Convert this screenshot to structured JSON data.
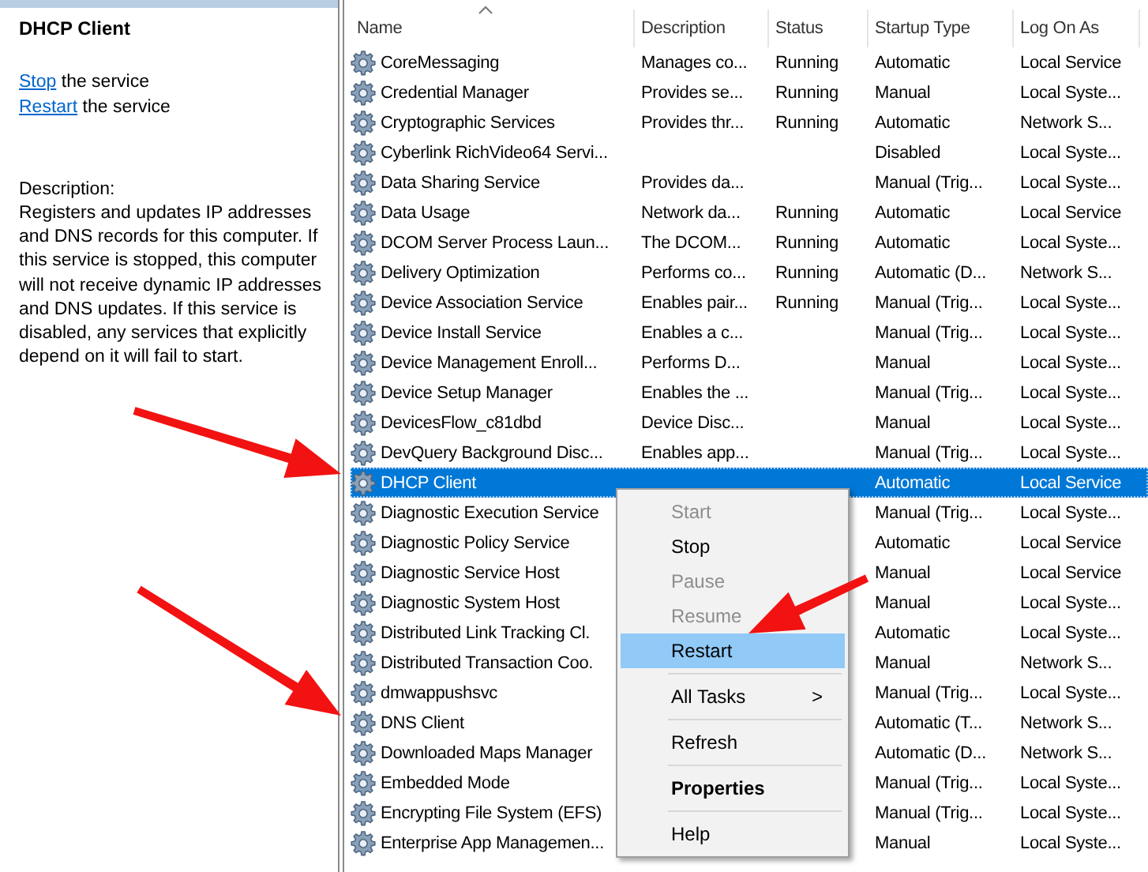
{
  "details": {
    "title": "DHCP Client",
    "actions": [
      {
        "link": "Stop",
        "text": "the service"
      },
      {
        "link": "Restart",
        "text": "the service"
      }
    ],
    "description_label": "Description:",
    "description": "Registers and updates IP addresses and DNS records for this computer. If this service is stopped, this computer will not receive dynamic IP addresses and DNS updates. If this service is disabled, any services that explicitly depend on it will fail to start."
  },
  "table": {
    "columns": [
      "Name",
      "Description",
      "Status",
      "Startup Type",
      "Log On As"
    ],
    "rows": [
      {
        "name": "CoreMessaging",
        "description": "Manages co...",
        "status": "Running",
        "startup": "Automatic",
        "logon": "Local Service",
        "selected": false
      },
      {
        "name": "Credential Manager",
        "description": "Provides se...",
        "status": "Running",
        "startup": "Manual",
        "logon": "Local Syste...",
        "selected": false
      },
      {
        "name": "Cryptographic Services",
        "description": "Provides thr...",
        "status": "Running",
        "startup": "Automatic",
        "logon": "Network S...",
        "selected": false
      },
      {
        "name": "Cyberlink RichVideo64 Servi...",
        "startup": "Disabled",
        "logon": "Local Syste...",
        "selected": false
      },
      {
        "name": "Data Sharing Service",
        "description": "Provides da...",
        "startup": "Manual (Trig...",
        "logon": "Local Syste...",
        "selected": false
      },
      {
        "name": "Data Usage",
        "description": "Network da...",
        "status": "Running",
        "startup": "Automatic",
        "logon": "Local Service",
        "selected": false
      },
      {
        "name": "DCOM Server Process Laun...",
        "description": "The DCOM...",
        "status": "Running",
        "startup": "Automatic",
        "logon": "Local Syste...",
        "selected": false
      },
      {
        "name": "Delivery Optimization",
        "description": "Performs co...",
        "status": "Running",
        "startup": "Automatic (D...",
        "logon": "Network S...",
        "selected": false
      },
      {
        "name": "Device Association Service",
        "description": "Enables pair...",
        "status": "Running",
        "startup": "Manual (Trig...",
        "logon": "Local Syste...",
        "selected": false
      },
      {
        "name": "Device Install Service",
        "description": "Enables a c...",
        "startup": "Manual (Trig...",
        "logon": "Local Syste...",
        "selected": false
      },
      {
        "name": "Device Management Enroll...",
        "description": "Performs D...",
        "startup": "Manual",
        "logon": "Local Syste...",
        "selected": false
      },
      {
        "name": "Device Setup Manager",
        "description": "Enables the ...",
        "startup": "Manual (Trig...",
        "logon": "Local Syste...",
        "selected": false
      },
      {
        "name": "DevicesFlow_c81dbd",
        "description": "Device Disc...",
        "startup": "Manual",
        "logon": "Local Syste...",
        "selected": false
      },
      {
        "name": "DevQuery Background Disc...",
        "description": "Enables app...",
        "startup": "Manual (Trig...",
        "logon": "Local Syste...",
        "selected": false
      },
      {
        "name": "DHCP Client",
        "startup": "Automatic",
        "logon": "Local Service",
        "selected": true
      },
      {
        "name": "Diagnostic Execution Service",
        "startup": "Manual (Trig...",
        "logon": "Local Syste...",
        "selected": false
      },
      {
        "name": "Diagnostic Policy Service",
        "startup": "Automatic",
        "logon": "Local Service",
        "selected": false
      },
      {
        "name": "Diagnostic Service Host",
        "startup": "Manual",
        "logon": "Local Service",
        "selected": false
      },
      {
        "name": "Diagnostic System Host",
        "startup": "Manual",
        "logon": "Local Syste...",
        "selected": false
      },
      {
        "name": "Distributed Link Tracking Cl.",
        "startup": "Automatic",
        "logon": "Local Syste...",
        "selected": false
      },
      {
        "name": "Distributed Transaction Coo.",
        "startup": "Manual",
        "logon": "Network S...",
        "selected": false
      },
      {
        "name": "dmwappushsvc",
        "startup": "Manual (Trig...",
        "logon": "Local Syste...",
        "selected": false
      },
      {
        "name": "DNS Client",
        "startup": "Automatic (T...",
        "logon": "Network S...",
        "selected": false
      },
      {
        "name": "Downloaded Maps Manager",
        "startup": "Automatic (D...",
        "logon": "Network S...",
        "selected": false
      },
      {
        "name": "Embedded Mode",
        "startup": "Manual (Trig...",
        "logon": "Local Syste...",
        "selected": false
      },
      {
        "name": "Encrypting File System (EFS)",
        "startup": "Manual (Trig...",
        "logon": "Local Syste...",
        "selected": false
      },
      {
        "name": "Enterprise App Managemen...",
        "startup": "Manual",
        "logon": "Local Syste...",
        "selected": false
      }
    ]
  },
  "context_menu": {
    "items": [
      {
        "kind": "item",
        "label": "Start",
        "disabled": true,
        "selected": false
      },
      {
        "kind": "item",
        "label": "Stop",
        "disabled": false,
        "selected": false
      },
      {
        "kind": "item",
        "label": "Pause",
        "disabled": true,
        "selected": false
      },
      {
        "kind": "item",
        "label": "Resume",
        "disabled": true,
        "selected": false
      },
      {
        "kind": "item",
        "label": "Restart",
        "disabled": false,
        "selected": true
      },
      {
        "kind": "separator"
      },
      {
        "kind": "submenu",
        "label": "All Tasks",
        "arrow": ">",
        "disabled": false,
        "selected": false
      },
      {
        "kind": "separator"
      },
      {
        "kind": "item",
        "label": "Refresh",
        "disabled": false,
        "selected": false
      },
      {
        "kind": "separator"
      },
      {
        "kind": "default",
        "label": "Properties",
        "disabled": false,
        "selected": false
      },
      {
        "kind": "separator"
      },
      {
        "kind": "item",
        "label": "Help",
        "disabled": false,
        "selected": false
      }
    ]
  }
}
